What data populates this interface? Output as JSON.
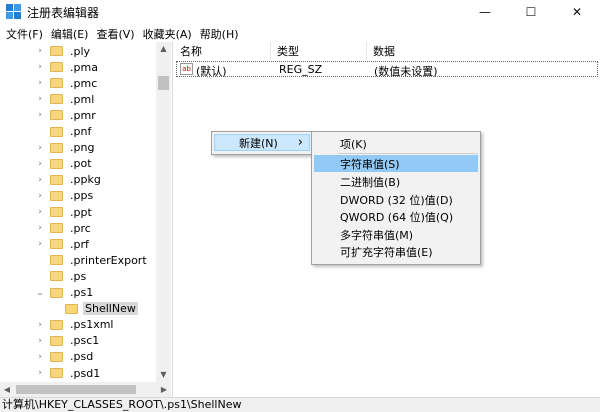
{
  "window": {
    "title": "注册表编辑器",
    "minimize_icon": "—",
    "maximize_icon": "☐",
    "close_icon": "✕"
  },
  "menu": [
    "文件(F)",
    "编辑(E)",
    "查看(V)",
    "收藏夹(A)",
    "帮助(H)"
  ],
  "tree": {
    "items": [
      {
        "label": ".ply",
        "expandable": true
      },
      {
        "label": ".pma",
        "expandable": true
      },
      {
        "label": ".pmc",
        "expandable": true
      },
      {
        "label": ".pml",
        "expandable": true
      },
      {
        "label": ".pmr",
        "expandable": true
      },
      {
        "label": ".pnf",
        "expandable": false
      },
      {
        "label": ".png",
        "expandable": true
      },
      {
        "label": ".pot",
        "expandable": true
      },
      {
        "label": ".ppkg",
        "expandable": true
      },
      {
        "label": ".pps",
        "expandable": true
      },
      {
        "label": ".ppt",
        "expandable": true
      },
      {
        "label": ".prc",
        "expandable": true
      },
      {
        "label": ".prf",
        "expandable": true
      },
      {
        "label": ".printerExport",
        "expandable": false
      },
      {
        "label": ".ps",
        "expandable": false
      },
      {
        "label": ".ps1",
        "expandable": true,
        "expanded": true
      },
      {
        "label": "ShellNew",
        "child": true,
        "selected": true
      },
      {
        "label": ".ps1xml",
        "expandable": true
      },
      {
        "label": ".psc1",
        "expandable": true
      },
      {
        "label": ".psd",
        "expandable": true
      },
      {
        "label": ".psd1",
        "expandable": true
      }
    ]
  },
  "list": {
    "headers": {
      "name": "名称",
      "type": "类型",
      "data": "数据"
    },
    "rows": [
      {
        "name": "(默认)",
        "type": "REG_SZ",
        "data": "(数值未设置)",
        "icon": "ab"
      }
    ]
  },
  "context_menu": {
    "new_label": "新建(N)",
    "arrow": "›"
  },
  "submenu": {
    "items": [
      "项(K)",
      "字符串值(S)",
      "二进制值(B)",
      "DWORD (32 位)值(D)",
      "QWORD (64 位)值(Q)",
      "多字符串值(M)",
      "可扩充字符串值(E)"
    ],
    "highlighted_index": 1
  },
  "status": {
    "path": "计算机\\HKEY_CLASSES_ROOT\\.ps1\\ShellNew"
  },
  "colors": {
    "selection": "#91c9f7",
    "folder": "#f6d77c"
  }
}
